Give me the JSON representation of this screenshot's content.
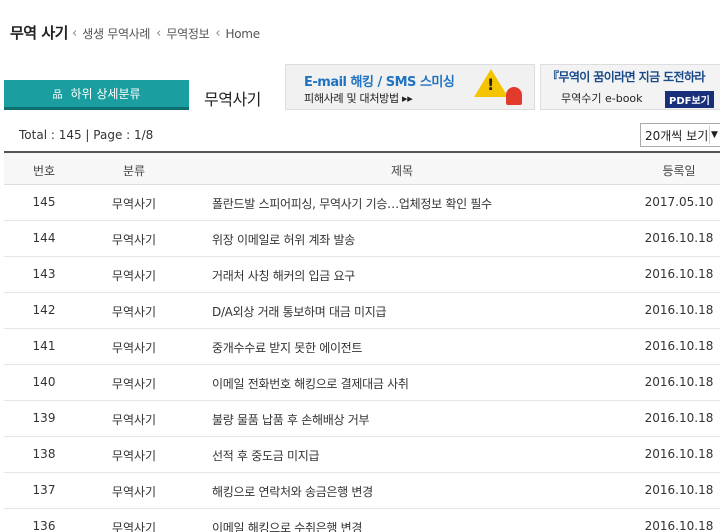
{
  "header": {
    "page_title": "무역 사기",
    "breadcrumb": [
      "생생 무역사례",
      "무역정보",
      "Home"
    ]
  },
  "category": {
    "sub_button_icon": "品",
    "sub_button_label": "하위 상세분류",
    "current": "무역사기"
  },
  "banners": {
    "phishing": {
      "line1": "E-mail 해킹 / SMS 스미싱",
      "line2": "피해사례 및 대처방법 ▸▸",
      "warn_icon": "!"
    },
    "ebook": {
      "line1": "『무역이 꿈이라면 지금 도전하라",
      "line2": "무역수기 e-book",
      "pdf_label": "PDF보기"
    }
  },
  "listing": {
    "total_text": "Total : 145 | Page : 1/8",
    "per_page": "20개씩 보기",
    "chevron": "▼"
  },
  "table": {
    "headers": {
      "num": "번호",
      "cat": "분류",
      "title": "제목",
      "date": "등록일"
    },
    "rows": [
      {
        "num": "145",
        "cat": "무역사기",
        "title": "폴란드발 스피어피싱, 무역사기 기승…업체정보 확인 필수",
        "date": "2017.05.10"
      },
      {
        "num": "144",
        "cat": "무역사기",
        "title": "위장 이메일로 허위 계좌 발송",
        "date": "2016.10.18"
      },
      {
        "num": "143",
        "cat": "무역사기",
        "title": "거래처 사칭 해커의 입금 요구",
        "date": "2016.10.18"
      },
      {
        "num": "142",
        "cat": "무역사기",
        "title": "D/A외상 거래 통보하며 대금 미지급",
        "date": "2016.10.18"
      },
      {
        "num": "141",
        "cat": "무역사기",
        "title": "중개수수료 받지 못한 에이전트",
        "date": "2016.10.18"
      },
      {
        "num": "140",
        "cat": "무역사기",
        "title": "이메일 전화번호 해킹으로 결제대금 사취",
        "date": "2016.10.18"
      },
      {
        "num": "139",
        "cat": "무역사기",
        "title": "불량 물품 납품 후 손해배상 거부",
        "date": "2016.10.18"
      },
      {
        "num": "138",
        "cat": "무역사기",
        "title": "선적 후 중도금 미지급",
        "date": "2016.10.18"
      },
      {
        "num": "137",
        "cat": "무역사기",
        "title": "해킹으로 연락처와 송금은행 변경",
        "date": "2016.10.18"
      },
      {
        "num": "136",
        "cat": "무역사기",
        "title": "이메일 해킹으로 수취은행 변경",
        "date": "2016.10.18"
      }
    ]
  }
}
